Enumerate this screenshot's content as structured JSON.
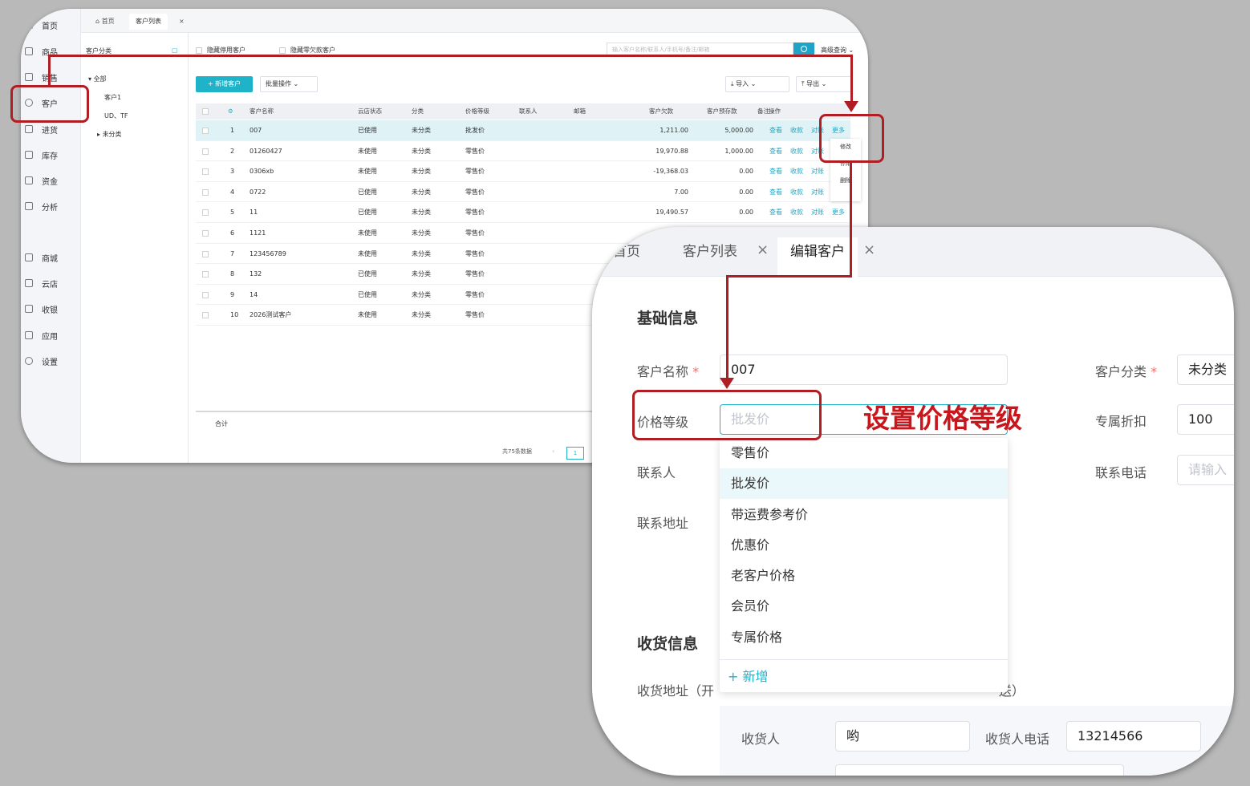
{
  "list_screen": {
    "sidebar": [
      {
        "label": "首页",
        "icon": "home-icon"
      },
      {
        "label": "商品",
        "icon": "goods-icon"
      },
      {
        "label": "销售",
        "icon": "sales-icon"
      },
      {
        "label": "客户",
        "icon": "user-icon"
      },
      {
        "label": "进货",
        "icon": "purchase-icon"
      },
      {
        "label": "库存",
        "icon": "stock-icon"
      },
      {
        "label": "资金",
        "icon": "wallet-icon"
      },
      {
        "label": "分析",
        "icon": "chart-icon"
      },
      {
        "label": "商城",
        "icon": "shop-icon"
      },
      {
        "label": "云店",
        "icon": "cloud-store-icon"
      },
      {
        "label": "收银",
        "icon": "cashier-icon"
      },
      {
        "label": "应用",
        "icon": "apps-icon"
      },
      {
        "label": "设置",
        "icon": "gear-icon"
      }
    ],
    "tabs": {
      "home": "首页",
      "list": "客户列表",
      "close": "×"
    },
    "category": {
      "title": "客户分类",
      "all": "全部",
      "items": [
        "客户1",
        "UD、TF",
        "未分类"
      ]
    },
    "filters": {
      "hide_disabled": "隐藏停用客户",
      "hide_zero": "隐藏零欠款客户"
    },
    "search": {
      "placeholder": "输入客户名称/联系人/手机号/备注/邮箱",
      "advanced": "高级查询"
    },
    "toolbar": {
      "add": "+ 新增客户",
      "batch": "批量操作",
      "import": "导入",
      "export": "导出"
    },
    "columns": [
      "客户名称",
      "云店状态",
      "分类",
      "价格等级",
      "联系人",
      "邮箱",
      "客户欠款",
      "客户预存款",
      "备注",
      "操作"
    ],
    "rows": [
      {
        "no": "1",
        "name": "007",
        "status": "已使用",
        "cat": "未分类",
        "price": "批发价",
        "debt": "1,211.00",
        "prepay": "5,000.00"
      },
      {
        "no": "2",
        "name": "01260427",
        "status": "未使用",
        "cat": "未分类",
        "price": "零售价",
        "debt": "19,970.88",
        "prepay": "1,000.00"
      },
      {
        "no": "3",
        "name": "0306xb",
        "status": "未使用",
        "cat": "未分类",
        "price": "零售价",
        "debt": "-19,368.03",
        "prepay": "0.00"
      },
      {
        "no": "4",
        "name": "0722",
        "status": "已使用",
        "cat": "未分类",
        "price": "零售价",
        "debt": "7.00",
        "prepay": "0.00"
      },
      {
        "no": "5",
        "name": "11",
        "status": "已使用",
        "cat": "未分类",
        "price": "零售价",
        "debt": "19,490.57",
        "prepay": "0.00"
      },
      {
        "no": "6",
        "name": "1121",
        "status": "未使用",
        "cat": "未分类",
        "price": "零售价",
        "debt": "",
        "prepay": ""
      },
      {
        "no": "7",
        "name": "123456789",
        "status": "未使用",
        "cat": "未分类",
        "price": "零售价",
        "debt": "",
        "prepay": ""
      },
      {
        "no": "8",
        "name": "132",
        "status": "已使用",
        "cat": "未分类",
        "price": "零售价",
        "debt": "",
        "prepay": ""
      },
      {
        "no": "9",
        "name": "14",
        "status": "已使用",
        "cat": "未分类",
        "price": "零售价",
        "debt": "",
        "prepay": ""
      },
      {
        "no": "10",
        "name": "2026测试客户",
        "status": "未使用",
        "cat": "未分类",
        "price": "零售价",
        "debt": "",
        "prepay": ""
      }
    ],
    "row_actions": {
      "view": "查看",
      "receive": "收款",
      "reconcile": "对账",
      "more": "更多"
    },
    "more_menu": [
      "修改",
      "停用",
      "删除"
    ],
    "total_label": "合计",
    "pager": {
      "total": "共75条数据",
      "page": "1"
    }
  },
  "edit_screen": {
    "tabs": {
      "home": "首页",
      "list": "客户列表",
      "edit": "编辑客户",
      "close": "×"
    },
    "basic_section": "基础信息",
    "name": {
      "label": "客户名称",
      "value": "007"
    },
    "category": {
      "label": "客户分类",
      "value": "未分类"
    },
    "price_level": {
      "label": "价格等级",
      "placeholder": "批发价"
    },
    "discount": {
      "label": "专属折扣",
      "value": "100"
    },
    "contact": {
      "label": "联系人"
    },
    "phone": {
      "label": "联系电话",
      "placeholder": "请输入"
    },
    "address": {
      "label": "联系地址"
    },
    "required_mark": "*",
    "price_options": [
      "零售价",
      "批发价",
      "带运费参考价",
      "优惠价",
      "老客户价格",
      "会员价",
      "专属价格"
    ],
    "add_new": "+ 新增",
    "delivery_section": "收货信息",
    "delivery_address_label": "收货地址（开",
    "delivery_address_tail": "送）",
    "receiver": {
      "label": "收货人",
      "value": "哟"
    },
    "receiver_phone": {
      "label": "收货人电话",
      "value": "13214566"
    }
  },
  "annotation": {
    "text": "设置价格等级",
    "color": "#c8161d"
  }
}
